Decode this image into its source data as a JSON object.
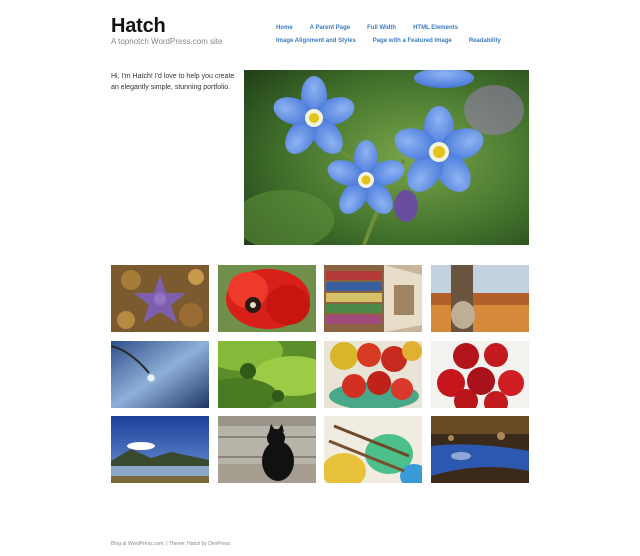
{
  "site": {
    "title": "Hatch",
    "description": "A topnotch WordPress.com site"
  },
  "nav": {
    "row1": [
      "Home",
      "A Parent Page",
      "Full Width",
      "HTML Elements"
    ],
    "row2": [
      "Image Alignment and Styles",
      "Page with a Featured Image",
      "Readability"
    ]
  },
  "intro": {
    "text": "Hi, I'm Hatch! I'd love to help you create an elegantly simple, stunning portfolio."
  },
  "hero": {
    "icon": "forget-me-not-flowers-image"
  },
  "portfolio": {
    "thumbnails": [
      "starfish-image",
      "red-poppy-image",
      "library-bookshelves-image",
      "autumn-field-image",
      "water-droplet-image",
      "green-hills-image",
      "apples-bowl-image",
      "red-apples-image",
      "lake-mountains-image",
      "black-cat-image",
      "paint-brushes-image",
      "forest-stream-image"
    ]
  },
  "footer": {
    "blog_link": "Blog at WordPress.com.",
    "separator": " | ",
    "theme_text": "Theme: Hatch by ",
    "theme_author": "DevPress",
    "period": "."
  },
  "colors": {
    "link": "#3b7bc2",
    "title": "#111111",
    "muted": "#888888"
  }
}
